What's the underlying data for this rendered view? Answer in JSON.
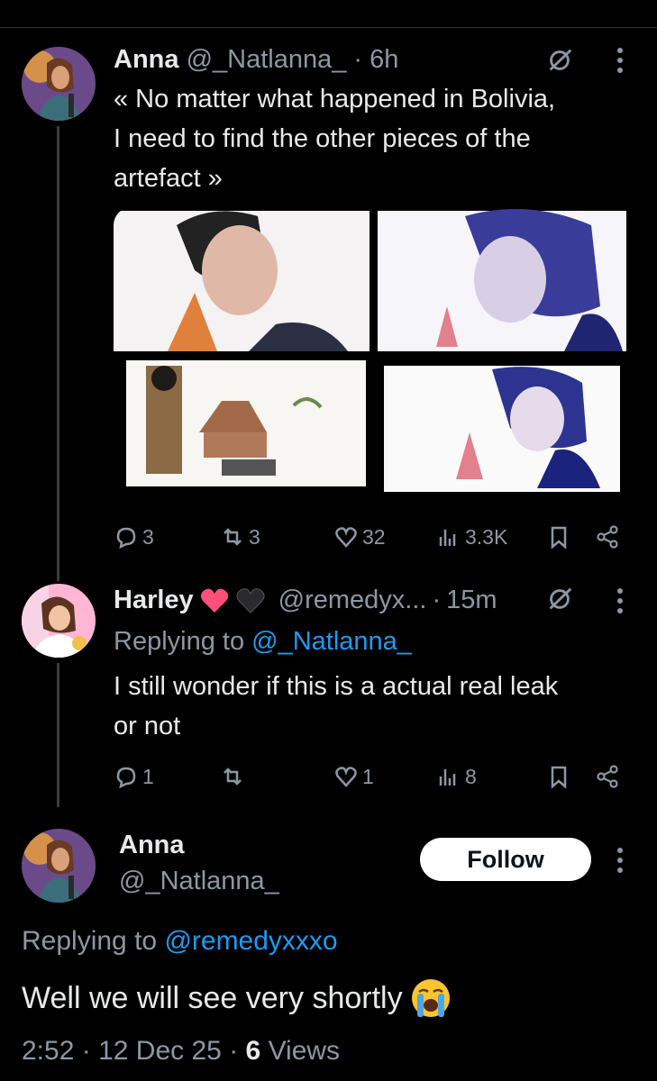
{
  "posts": [
    {
      "name": "Anna",
      "handle": "@_Natlanna_",
      "sep": "·",
      "time": "6h",
      "text_lines": [
        "« No matter what happened in Bolivia,",
        "I need to find the other pieces of the",
        "artefact »"
      ],
      "stats": {
        "replies": "3",
        "reposts": "3",
        "likes": "32",
        "views": "3.3K"
      }
    },
    {
      "name": "Harley",
      "handle": "@remedyx...",
      "sep": "·",
      "time": "15m",
      "replying_prefix": "Replying to",
      "replying_to": "@_Natlanna_",
      "text_lines": [
        "I still wonder if this is a actual real leak",
        "or not"
      ],
      "stats": {
        "replies": "1",
        "reposts": "",
        "likes": "1",
        "views": "8"
      }
    }
  ],
  "focused": {
    "name": "Anna",
    "handle": "@_Natlanna_",
    "follow_label": "Follow",
    "replying_prefix": "Replying to",
    "replying_to": "@remedyxxxo",
    "text": "Well we will see very shortly",
    "emoji": "loudly-crying-face",
    "time": "2:52",
    "date": "12 Dec 25",
    "sep": "·",
    "views_count": "6",
    "views_label": "Views"
  },
  "colors": {
    "background": "#000000",
    "text": "#e7e9ea",
    "muted": "#8b98a5",
    "link": "#1d9bf0"
  }
}
